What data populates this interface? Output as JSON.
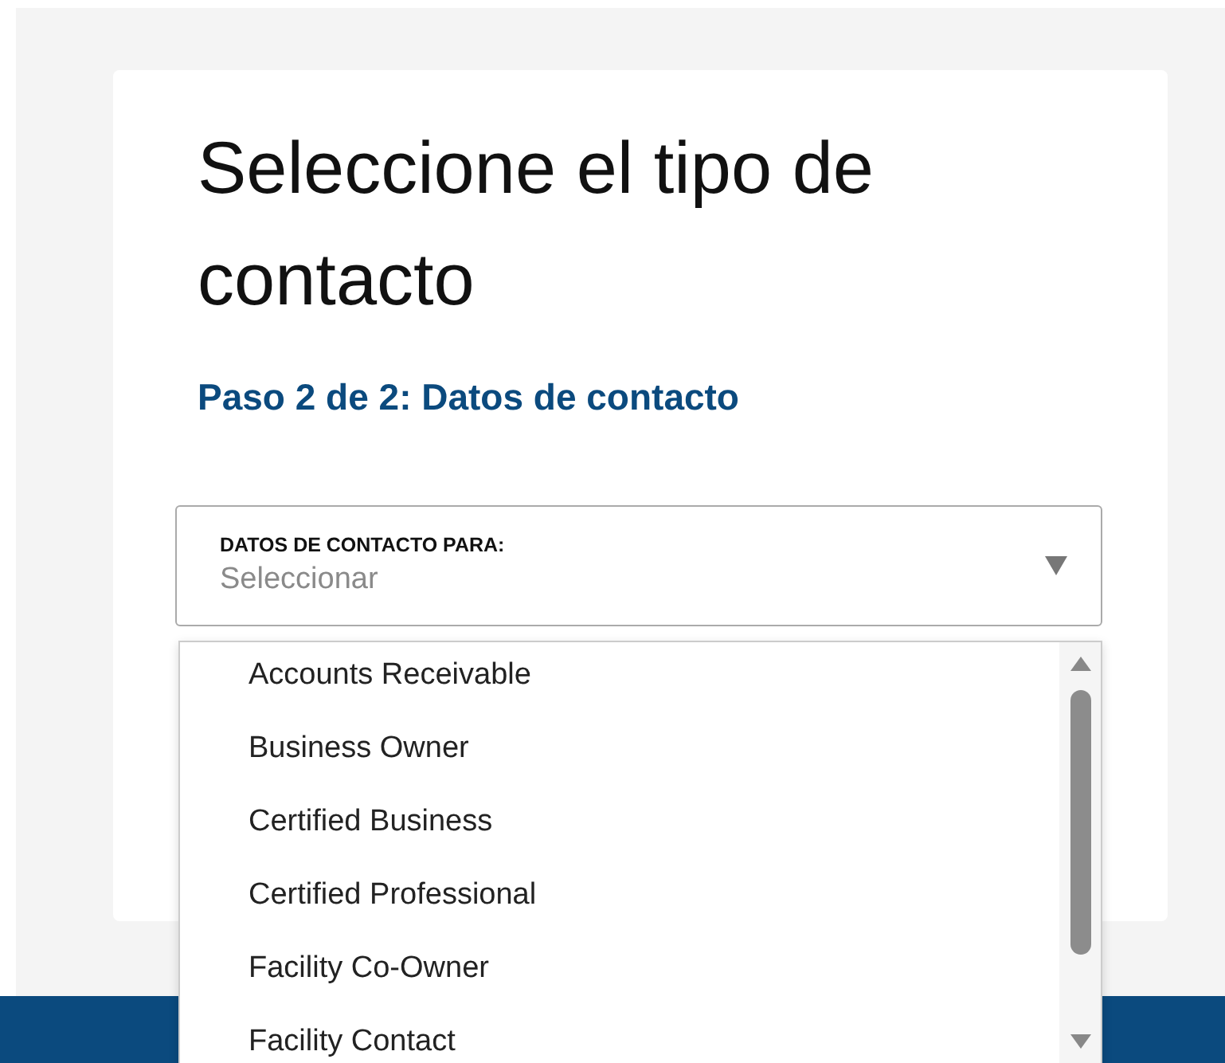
{
  "heading": "Seleccione el tipo de contacto",
  "step": "Paso 2 de 2: Datos de contacto",
  "select": {
    "label": "DATOS DE CONTACTO PARA:",
    "placeholder": "Seleccionar",
    "expanded": true
  },
  "options": [
    {
      "label": "Accounts Receivable",
      "selected": false
    },
    {
      "label": "Business Owner",
      "selected": false
    },
    {
      "label": "Certified Business",
      "selected": false
    },
    {
      "label": "Certified Professional",
      "selected": false
    },
    {
      "label": "Facility Co-Owner",
      "selected": false
    },
    {
      "label": "Facility Contact",
      "selected": false
    }
  ]
}
